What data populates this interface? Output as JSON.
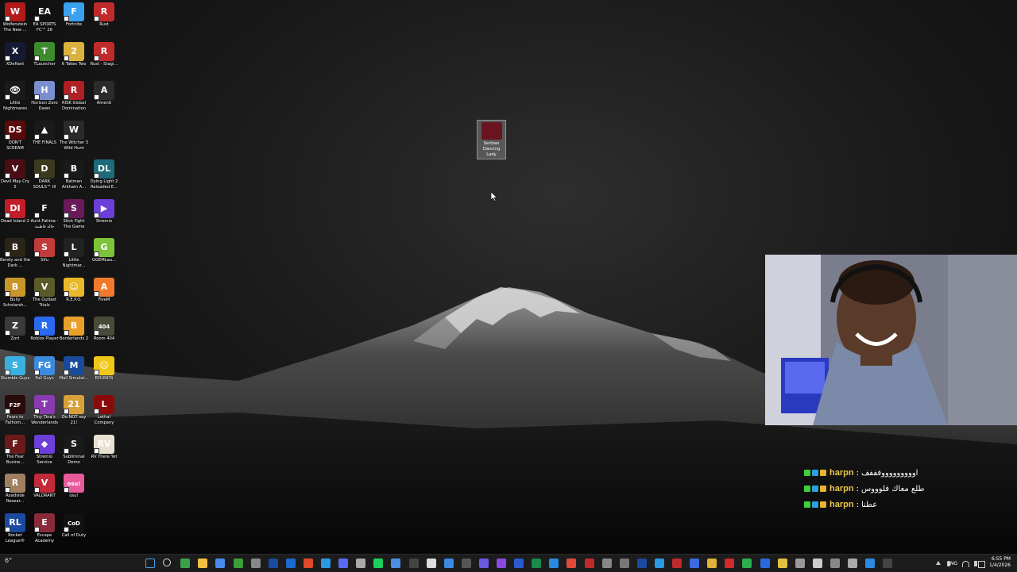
{
  "desktop": {
    "icons": [
      {
        "label": "Wolfenstein The New ...",
        "color": "#b31b1b",
        "glyph": "W"
      },
      {
        "label": "EA SPORTS FC™ 26",
        "color": "#111111",
        "glyph": "EA"
      },
      {
        "label": "Fortnite",
        "color": "#3aa0f0",
        "glyph": "F"
      },
      {
        "label": "Rust",
        "color": "#c02a2a",
        "glyph": "R"
      },
      {
        "label": "XDefiant",
        "color": "#141a33",
        "glyph": "X"
      },
      {
        "label": "TLauncher",
        "color": "#3d8b2e",
        "glyph": "T"
      },
      {
        "label": "It Takes Two",
        "color": "#d9b13c",
        "glyph": "2"
      },
      {
        "label": "Rust - Stagi...",
        "color": "#c02a2a",
        "glyph": "R"
      },
      {
        "label": "Little Nightmares",
        "color": "#1a1a1a",
        "glyph": "👁"
      },
      {
        "label": "Horizon Zero Dawn",
        "color": "#7a8fd0",
        "glyph": "H"
      },
      {
        "label": "RISK Global Domination",
        "color": "#b01f24",
        "glyph": "R"
      },
      {
        "label": "Amenti",
        "color": "#2b2b2b",
        "glyph": "A"
      },
      {
        "label": "DON'T SCREAM",
        "color": "#5a0a0a",
        "glyph": "DS"
      },
      {
        "label": "THE FINALS",
        "color": "#1a1a1a",
        "glyph": "▲"
      },
      {
        "label": "The Witcher 3 Wild Hunt",
        "color": "#2a2a2a",
        "glyph": "W"
      },
      {
        "label": "",
        "color": "transparent",
        "glyph": ""
      },
      {
        "label": "Devil May Cry 5",
        "color": "#4a0d14",
        "glyph": "V"
      },
      {
        "label": "DARK SOULS™ III",
        "color": "#3b3a1e",
        "glyph": "D"
      },
      {
        "label": "Batman Arkham A...",
        "color": "#1a1a1a",
        "glyph": "B"
      },
      {
        "label": "Dying Light 2 Reloaded E...",
        "color": "#1d6b7a",
        "glyph": "DL"
      },
      {
        "label": "Dead Island 2",
        "color": "#c41d2a",
        "glyph": "DI"
      },
      {
        "label": "Aunt Fatima - خالة فاطمة",
        "color": "#151515",
        "glyph": "F"
      },
      {
        "label": "Stick Fight The Game",
        "color": "#6a1a5a",
        "glyph": "S"
      },
      {
        "label": "Stremio",
        "color": "#6b3fd8",
        "glyph": "▶"
      },
      {
        "label": "Bendy and the Dark ...",
        "color": "#2b2417",
        "glyph": "B"
      },
      {
        "label": "Sifu",
        "color": "#c23a3a",
        "glyph": "S"
      },
      {
        "label": "Little Nightmar...",
        "color": "#222222",
        "glyph": "L"
      },
      {
        "label": "GGEMLau...",
        "color": "#7ec23a",
        "glyph": "G"
      },
      {
        "label": "Bully Scholarsh...",
        "color": "#c8962a",
        "glyph": "B"
      },
      {
        "label": "The Outlast Trials",
        "color": "#5b5a2a",
        "glyph": "V"
      },
      {
        "label": "R.E.P.O.",
        "color": "#e8b82a",
        "glyph": "☺"
      },
      {
        "label": "FiveM",
        "color": "#f07a2a",
        "glyph": "A"
      },
      {
        "label": "Zort",
        "color": "#3a3a3a",
        "glyph": "Z"
      },
      {
        "label": "Roblox Player",
        "color": "#2a6af0",
        "glyph": "R"
      },
      {
        "label": "Borderlands 2",
        "color": "#e8a02a",
        "glyph": "B"
      },
      {
        "label": "Room 404",
        "color": "#4a4a3a",
        "glyph": "404"
      },
      {
        "label": "Stumble Guys",
        "color": "#3ab0e0",
        "glyph": "S"
      },
      {
        "label": "Fall Guys",
        "color": "#3a8ae0",
        "glyph": "FG"
      },
      {
        "label": "Mall Simulat...",
        "color": "#1a4a9a",
        "glyph": "M"
      },
      {
        "label": "ROUNDS",
        "color": "#f0c81a",
        "glyph": "☹"
      },
      {
        "label": "Fears to Fathom...",
        "color": "#2a0a0a",
        "glyph": "F2F"
      },
      {
        "label": "Tiny Tina's Wonderlands",
        "color": "#8a3ab0",
        "glyph": "T"
      },
      {
        "label": "Do NOT say 21!",
        "color": "#d9a03a",
        "glyph": "21"
      },
      {
        "label": "Lethal Company",
        "color": "#8a0a0a",
        "glyph": "L"
      },
      {
        "label": "The Fear Busine...",
        "color": "#6a1a1a",
        "glyph": "F"
      },
      {
        "label": "Stremio Service",
        "color": "#6b3fd8",
        "glyph": "◆"
      },
      {
        "label": "Subliminal Demo",
        "color": "#1a1a1a",
        "glyph": "S"
      },
      {
        "label": "RV There Yet",
        "color": "#e8e0d0",
        "glyph": "RV"
      },
      {
        "label": "Roadside Resear...",
        "color": "#a08060",
        "glyph": "R"
      },
      {
        "label": "VALORANT",
        "color": "#c22a3a",
        "glyph": "V"
      },
      {
        "label": "osu!",
        "color": "#e85a9a",
        "glyph": "osu!"
      },
      {
        "label": "",
        "color": "transparent",
        "glyph": ""
      },
      {
        "label": "Rocket League®",
        "color": "#1a4aa0",
        "glyph": "RL"
      },
      {
        "label": "Escape Academy",
        "color": "#8a2a3a",
        "glyph": "E"
      },
      {
        "label": "Call of Duty",
        "color": "#111111",
        "glyph": "CoD"
      }
    ],
    "selected_icon": {
      "label": "Serbian Dancing Lady"
    }
  },
  "chat": {
    "lines": [
      {
        "user": "harpn",
        "message": "اوووووووووفففف"
      },
      {
        "user": "harpn",
        "message": "طلع معاك فلوووس"
      },
      {
        "user": "harpn",
        "message": "عطنا"
      }
    ],
    "badge_colors": [
      "#3ad13a",
      "#2aa0e0",
      "#e8b42a"
    ]
  },
  "taskbar": {
    "weather_text": "6°",
    "language": "ENG",
    "time": "6:55 PM",
    "date": "1/4/2026",
    "icons": [
      "windows-start-icon",
      "search-icon",
      "chrome-icon",
      "file-explorer-icon",
      "store-icon",
      "xbox-icon",
      "terminal-icon",
      "steam-icon",
      "outlook-icon",
      "brave-icon",
      "edge-icon",
      "discord-icon",
      "settings-icon",
      "spotify-icon",
      "photos-icon",
      "obs-icon",
      "epic-icon",
      "notepad-icon",
      "calculator-icon",
      "teams-icon",
      "twitch-icon",
      "word-icon",
      "excel-icon",
      "vscode-icon",
      "chrome-alt-icon",
      "adobe-icon",
      "media-icon",
      "snip-icon",
      "steam-alt-icon",
      "edge-alt-icon",
      "shield-icon",
      "game-icon",
      "folder-icon",
      "red-app-icon",
      "green-app-icon",
      "blue-app-icon",
      "yellow-app-icon",
      "tool-icon",
      "home-icon",
      "monitor-icon",
      "gallery-icon",
      "phone-icon",
      "app-icon"
    ],
    "icon_colors": [
      "#4aa0f0",
      "#dddddd",
      "#3aa04a",
      "#f0c040",
      "#4a8af0",
      "#3aa03a",
      "#888888",
      "#1a4aa0",
      "#1a6ad0",
      "#e04a2a",
      "#2a9ae0",
      "#5a6af0",
      "#aaaaaa",
      "#1ad05a",
      "#4a90e0",
      "#444444",
      "#dddddd",
      "#3a8ae0",
      "#555555",
      "#6a5ae0",
      "#8a4ae0",
      "#2a5ad0",
      "#1a8a4a",
      "#2a8ae0",
      "#e04a3a",
      "#c02a2a",
      "#888888",
      "#777777",
      "#1a4aa0",
      "#2a9ae0",
      "#c02a2a",
      "#3a6ae0",
      "#e0b03a",
      "#d02a2a",
      "#2ab04a",
      "#2a6ae0",
      "#e0c040",
      "#999999",
      "#cccccc",
      "#888888",
      "#aaaaaa",
      "#2a8ae0",
      "#444444"
    ]
  }
}
